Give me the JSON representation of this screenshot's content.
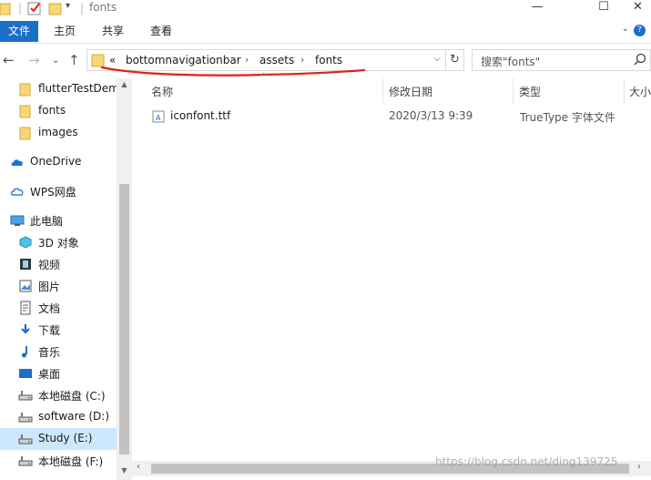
{
  "window": {
    "title": "fonts",
    "minimize_glyph": "—",
    "maximize_glyph": "☐",
    "close_glyph": "✕"
  },
  "ribbon": {
    "tabs": [
      "文件",
      "主页",
      "共享",
      "查看"
    ],
    "expand_glyph": "⌄",
    "help_glyph": "?"
  },
  "address_bar": {
    "overflow": "«",
    "segments": [
      "bottomnavigationbar",
      "assets",
      "fonts"
    ],
    "separator": "›",
    "dropdown": "⌵",
    "refresh": "↻"
  },
  "search": {
    "placeholder": "搜索\"fonts\""
  },
  "nav": {
    "back": "←",
    "forward": "→",
    "recent": "⌄",
    "up": "↑"
  },
  "navpane": {
    "items": [
      {
        "label": "flutterTestDem",
        "icon": "folder-icon"
      },
      {
        "label": "fonts",
        "icon": "folder-icon"
      },
      {
        "label": "images",
        "icon": "folder-icon"
      },
      {
        "label": "OneDrive",
        "icon": "onedrive-cloud-icon"
      },
      {
        "label": "WPS网盘",
        "icon": "wps-cloud-icon"
      },
      {
        "label": "此电脑",
        "icon": "computer-icon"
      },
      {
        "label": "3D 对象",
        "icon": "3d-objects-icon"
      },
      {
        "label": "视频",
        "icon": "video-icon"
      },
      {
        "label": "图片",
        "icon": "pictures-icon"
      },
      {
        "label": "文档",
        "icon": "documents-icon"
      },
      {
        "label": "下载",
        "icon": "download-icon"
      },
      {
        "label": "音乐",
        "icon": "music-icon"
      },
      {
        "label": "桌面",
        "icon": "desktop-icon"
      },
      {
        "label": "本地磁盘 (C:)",
        "icon": "drive-icon"
      },
      {
        "label": "software (D:)",
        "icon": "drive-icon"
      },
      {
        "label": "Study (E:)",
        "icon": "drive-icon",
        "selected": true
      },
      {
        "label": "本地磁盘 (F:)",
        "icon": "drive-icon"
      }
    ]
  },
  "columns": {
    "name": "名称",
    "modified": "修改日期",
    "type": "类型",
    "size": "大小"
  },
  "files": [
    {
      "name": "iconfont.ttf",
      "modified": "2020/3/13 9:39",
      "type": "TrueType 字体文件"
    }
  ],
  "watermark": "https://blog.csdn.net/ding139725",
  "colors": {
    "accent": "#1c6fc7",
    "selected": "#cce8ff",
    "annotation": "#e0201c",
    "folder": "#f8d775"
  }
}
